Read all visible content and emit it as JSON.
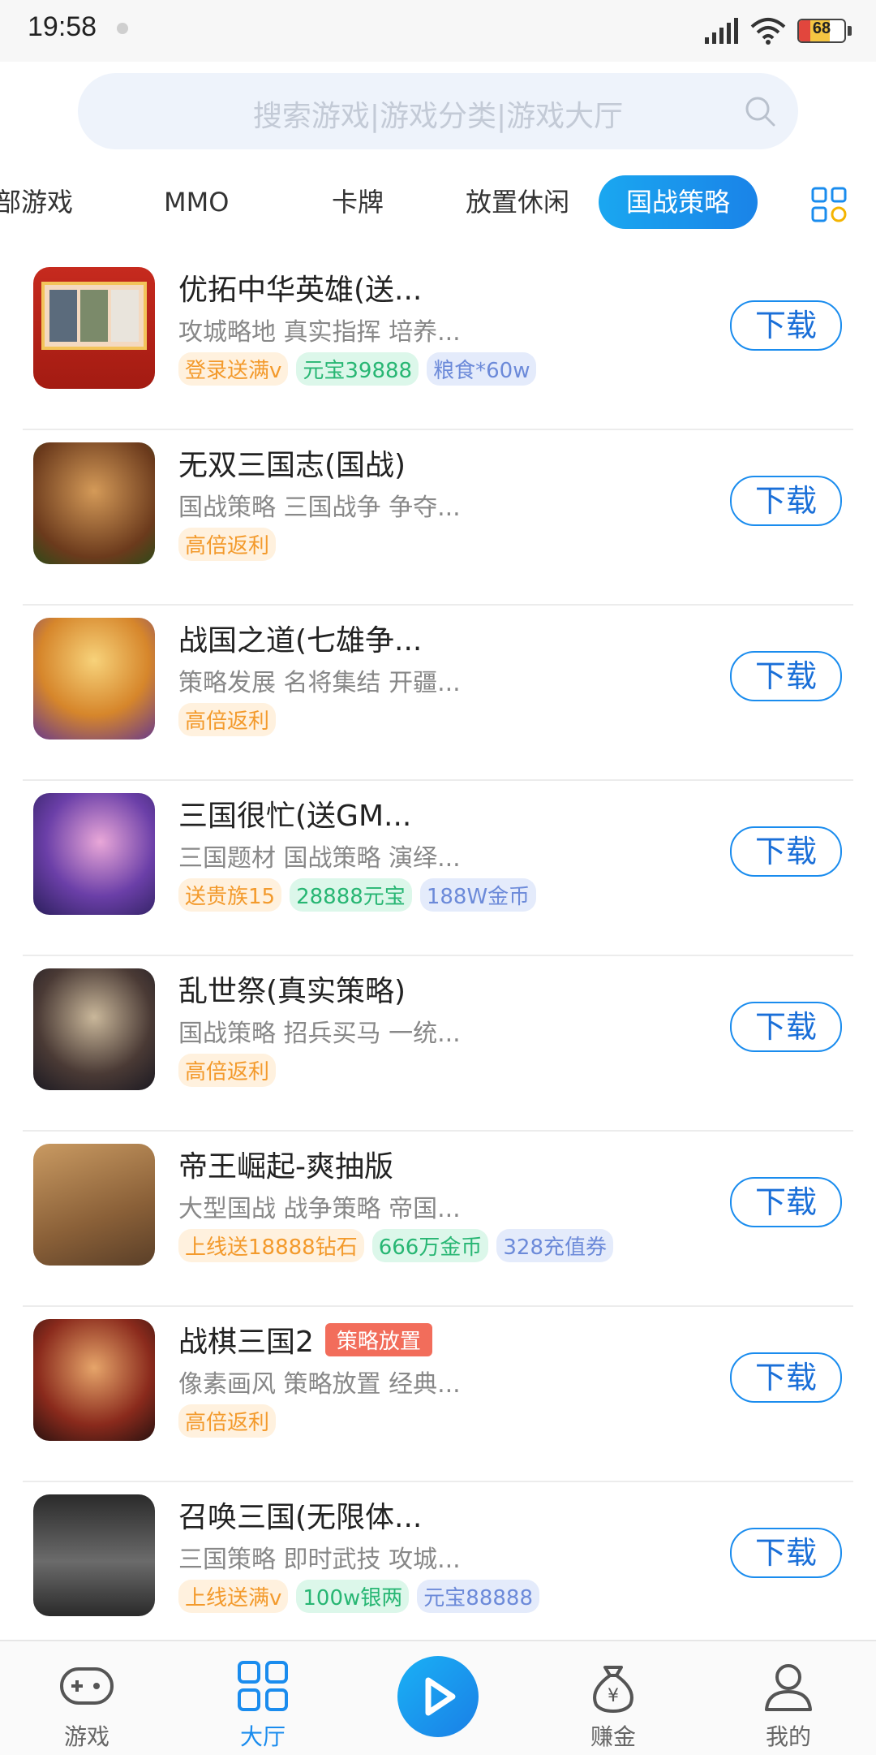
{
  "status": {
    "time": "19:58",
    "battery": "68"
  },
  "search": {
    "placeholder": "搜索游戏|游戏分类|游戏大厅"
  },
  "tabs": [
    "部游戏",
    "MMO",
    "卡牌",
    "放置休闲",
    "国战策略"
  ],
  "active_tab": "国战策略",
  "download_label": "下载",
  "games": [
    {
      "name": "优拓中华英雄(送...",
      "desc": "攻城略地 真实指挥 培养...",
      "tags": [
        "登录送满v",
        "元宝39888",
        "粮食*60w"
      ]
    },
    {
      "name": "无双三国志(国战)",
      "desc": "国战策略 三国战争 争夺...",
      "tags": [
        "高倍返利"
      ]
    },
    {
      "name": "战国之道(七雄争...",
      "desc": "策略发展 名将集结 开疆...",
      "tags": [
        "高倍返利"
      ]
    },
    {
      "name": "三国很忙(送GM...",
      "desc": "三国题材 国战策略 演绎...",
      "tags": [
        "送贵族15",
        "28888元宝",
        "188W金币"
      ]
    },
    {
      "name": "乱世祭(真实策略)",
      "desc": "国战策略 招兵买马 一统...",
      "tags": [
        "高倍返利"
      ]
    },
    {
      "name": "帝王崛起-爽抽版",
      "desc": "大型国战 战争策略 帝国...",
      "tags": [
        "上线送18888钻石",
        "666万金币",
        "328充值券"
      ]
    },
    {
      "name": "战棋三国2",
      "badge": "策略放置",
      "desc": "像素画风 策略放置 经典...",
      "tags": [
        "高倍返利"
      ]
    },
    {
      "name": "召唤三国(无限体...",
      "desc": "三国策略 即时武技 攻城...",
      "tags": [
        "上线送满v",
        "100w银两",
        "元宝88888"
      ]
    }
  ],
  "nav": {
    "games": "游戏",
    "hall": "大厅",
    "earn": "赚金",
    "mine": "我的"
  },
  "colors": {
    "accent": "#1a8cee",
    "tag_orange": "#f39a2c",
    "tag_green": "#27b673",
    "tag_blue": "#6c8ad9",
    "badge_red": "#f26d5b"
  }
}
